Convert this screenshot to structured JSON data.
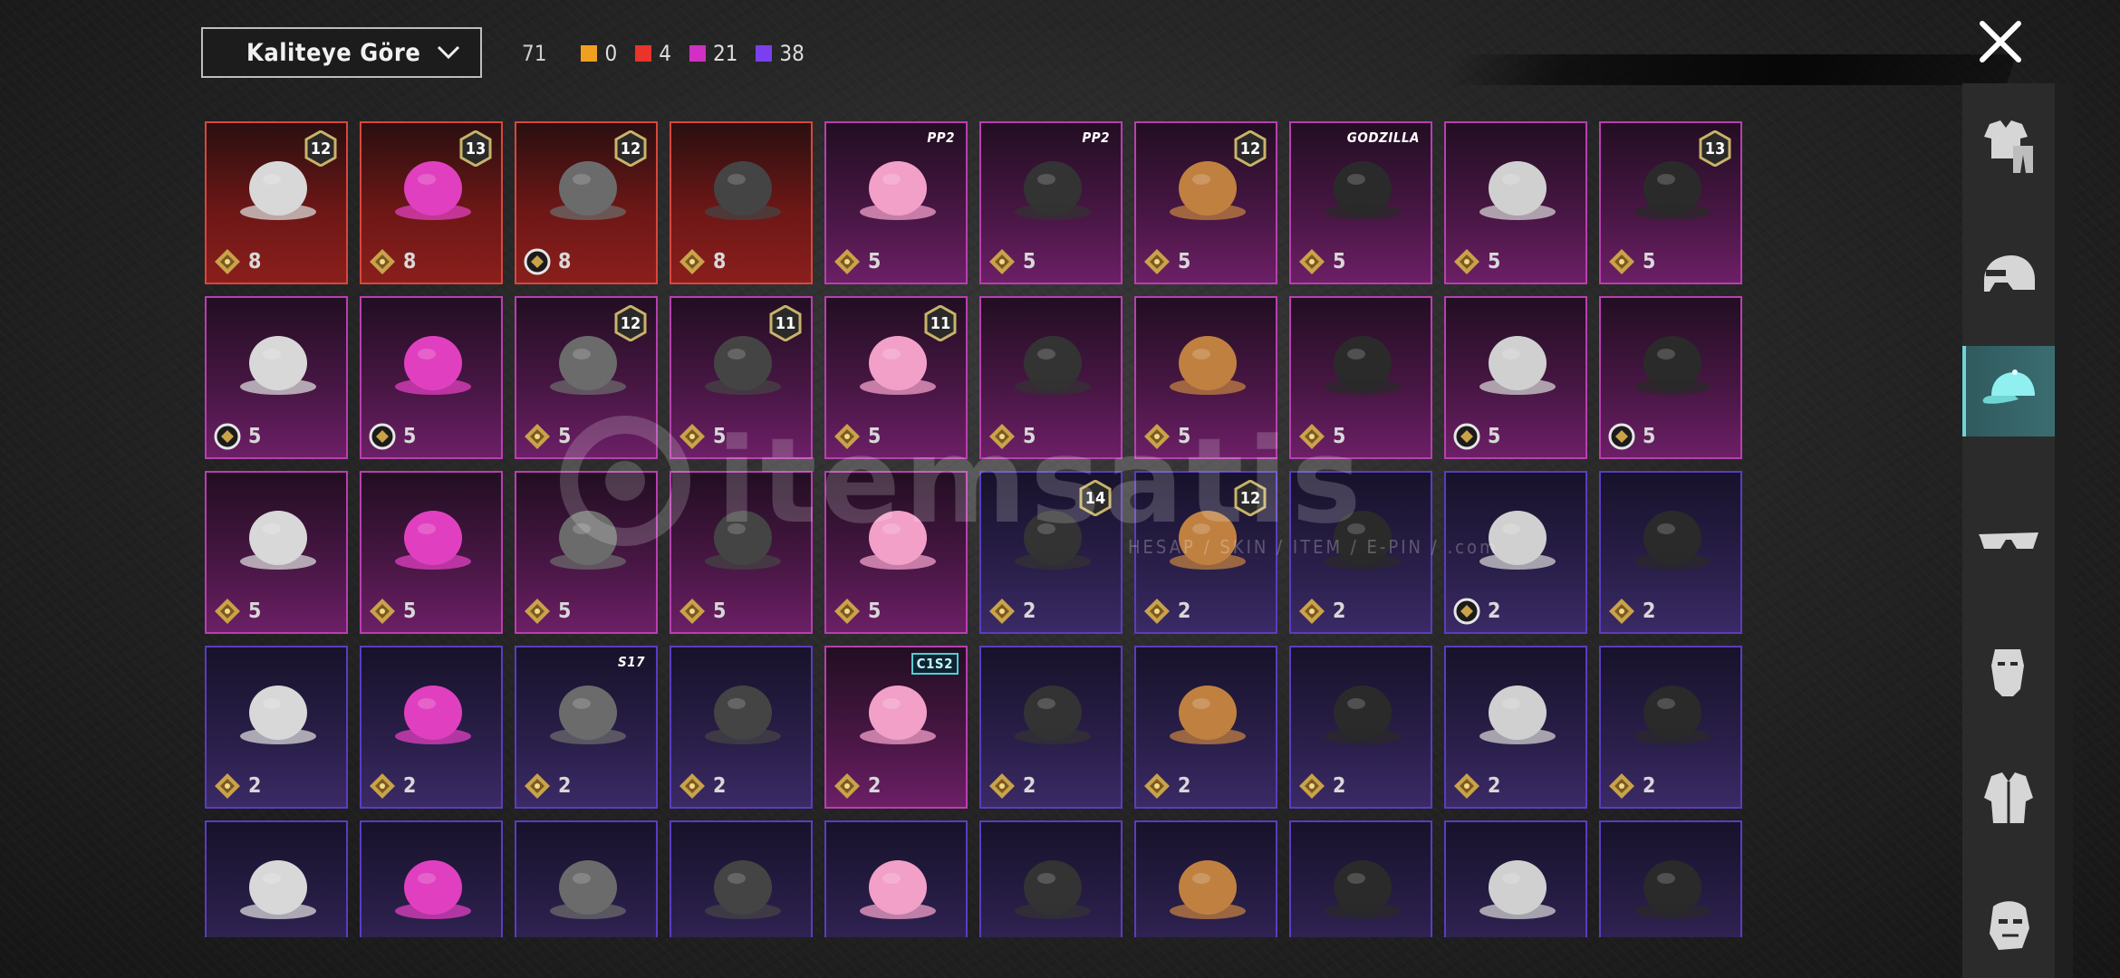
{
  "header": {
    "sort_label": "Kaliteye Göre",
    "total_count": "71",
    "counts": [
      {
        "color": "#f0a020",
        "value": "0"
      },
      {
        "color": "#e8342a",
        "value": "4"
      },
      {
        "color": "#d22fc4",
        "value": "21"
      },
      {
        "color": "#7b3ff0",
        "value": "38"
      }
    ]
  },
  "watermark": {
    "brand": "itemsatis",
    "tagline": "HESAP / SKIN / ITEM / E-PIN / .com"
  },
  "rail": {
    "categories": [
      {
        "name": "outfit",
        "icon": "outfit-icon"
      },
      {
        "name": "helmet",
        "icon": "helmet-icon"
      },
      {
        "name": "hat",
        "icon": "cap-icon",
        "active": true
      },
      {
        "name": "glasses",
        "icon": "glasses-icon"
      },
      {
        "name": "mask",
        "icon": "mask-icon"
      },
      {
        "name": "jacket",
        "icon": "jacket-icon"
      },
      {
        "name": "face",
        "icon": "face-icon"
      }
    ]
  },
  "items": [
    {
      "rarity": "red",
      "badge": "12",
      "cost": "8",
      "coin": "gold"
    },
    {
      "rarity": "red",
      "badge": "13",
      "cost": "8",
      "coin": "gold"
    },
    {
      "rarity": "red",
      "badge": "12",
      "cost": "8",
      "coin": "white"
    },
    {
      "rarity": "red",
      "cost": "8",
      "coin": "gold"
    },
    {
      "rarity": "pink",
      "tag": "PP2",
      "cost": "5",
      "coin": "gold"
    },
    {
      "rarity": "pink",
      "tag": "PP2",
      "cost": "5",
      "coin": "gold"
    },
    {
      "rarity": "pink",
      "badge": "12",
      "cost": "5",
      "coin": "gold"
    },
    {
      "rarity": "pink",
      "tag": "GODZILLA",
      "cost": "5",
      "coin": "gold"
    },
    {
      "rarity": "pink",
      "cost": "5",
      "coin": "gold"
    },
    {
      "rarity": "pink",
      "badge": "13",
      "cost": "5",
      "coin": "gold"
    },
    {
      "rarity": "pink",
      "cost": "5",
      "coin": "white"
    },
    {
      "rarity": "pink",
      "cost": "5",
      "coin": "white"
    },
    {
      "rarity": "pink",
      "badge": "12",
      "cost": "5",
      "coin": "gold"
    },
    {
      "rarity": "pink",
      "badge": "11",
      "cost": "5",
      "coin": "gold"
    },
    {
      "rarity": "pink",
      "badge": "11",
      "cost": "5",
      "coin": "gold"
    },
    {
      "rarity": "pink",
      "cost": "5",
      "coin": "gold"
    },
    {
      "rarity": "pink",
      "cost": "5",
      "coin": "gold"
    },
    {
      "rarity": "pink",
      "cost": "5",
      "coin": "gold"
    },
    {
      "rarity": "pink",
      "cost": "5",
      "coin": "white"
    },
    {
      "rarity": "pink",
      "cost": "5",
      "coin": "white"
    },
    {
      "rarity": "pink",
      "cost": "5",
      "coin": "gold"
    },
    {
      "rarity": "pink",
      "cost": "5",
      "coin": "gold"
    },
    {
      "rarity": "pink",
      "cost": "5",
      "coin": "gold"
    },
    {
      "rarity": "pink",
      "cost": "5",
      "coin": "gold"
    },
    {
      "rarity": "pink",
      "cost": "5",
      "coin": "gold"
    },
    {
      "rarity": "purple",
      "badge": "14",
      "cost": "2",
      "coin": "gold"
    },
    {
      "rarity": "purple",
      "badge": "12",
      "cost": "2",
      "coin": "gold"
    },
    {
      "rarity": "purple",
      "cost": "2",
      "coin": "gold"
    },
    {
      "rarity": "purple",
      "cost": "2",
      "coin": "white"
    },
    {
      "rarity": "purple",
      "cost": "2",
      "coin": "gold"
    },
    {
      "rarity": "purple",
      "cost": "2",
      "coin": "gold"
    },
    {
      "rarity": "purple",
      "cost": "2",
      "coin": "gold"
    },
    {
      "rarity": "purple",
      "tag": "S17",
      "cost": "2",
      "coin": "gold"
    },
    {
      "rarity": "purple",
      "cost": "2",
      "coin": "gold"
    },
    {
      "rarity": "pink",
      "tag": "C1S2",
      "cost": "2",
      "coin": "gold"
    },
    {
      "rarity": "purple",
      "cost": "2",
      "coin": "gold"
    },
    {
      "rarity": "purple",
      "cost": "2",
      "coin": "gold"
    },
    {
      "rarity": "purple",
      "cost": "2",
      "coin": "gold"
    },
    {
      "rarity": "purple",
      "cost": "2",
      "coin": "gold"
    },
    {
      "rarity": "purple",
      "cost": "2",
      "coin": "gold"
    },
    {
      "rarity": "purple"
    },
    {
      "rarity": "purple"
    },
    {
      "rarity": "purple"
    },
    {
      "rarity": "purple"
    },
    {
      "rarity": "purple"
    },
    {
      "rarity": "purple"
    },
    {
      "rarity": "purple"
    },
    {
      "rarity": "purple"
    },
    {
      "rarity": "purple"
    },
    {
      "rarity": "purple"
    }
  ]
}
